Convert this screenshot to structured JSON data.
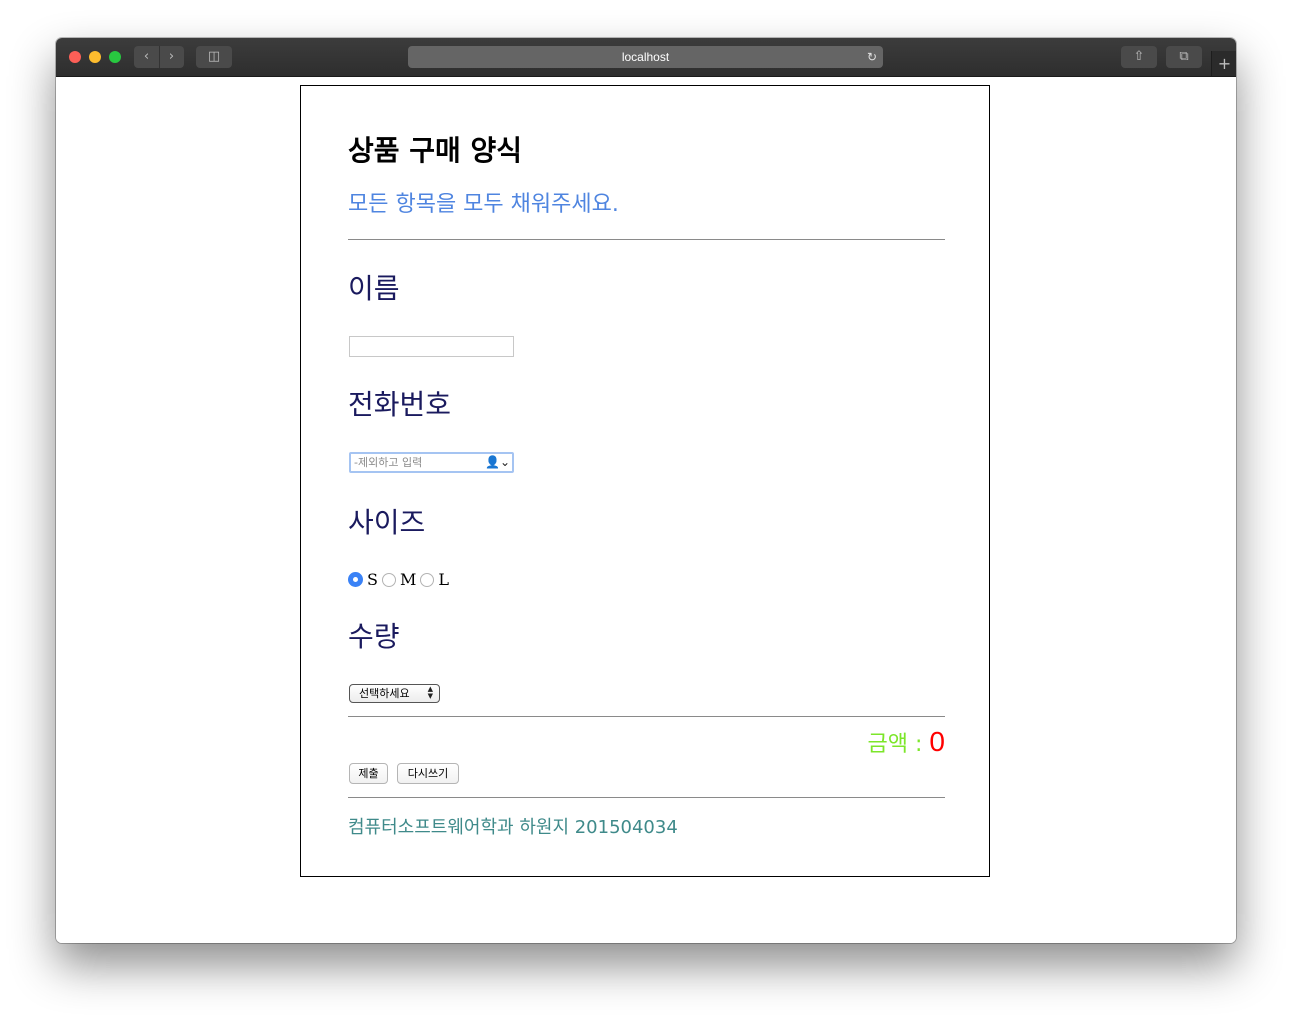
{
  "browser": {
    "url": "localhost",
    "back_icon": "chevron-left-icon",
    "forward_icon": "chevron-right-icon",
    "reload_icon": "reload-icon",
    "share_icon": "share-icon",
    "tabs_icon": "tabs-icon",
    "new_tab_label": "+"
  },
  "form": {
    "title": "상품 구매 양식",
    "subtitle": "모든 항목을 모두 채워주세요.",
    "name_label": "이름",
    "name_value": "",
    "phone_label": "전화번호",
    "phone_placeholder": "-제외하고 입력",
    "size_label": "사이즈",
    "size_options": [
      {
        "label": "S",
        "checked": true
      },
      {
        "label": "M",
        "checked": false
      },
      {
        "label": "L",
        "checked": false
      }
    ],
    "quantity_label": "수량",
    "quantity_selected": "선택하세요",
    "price_label": "금액 : ",
    "price_value": "0",
    "submit_label": "제출",
    "reset_label": "다시쓰기",
    "footer": "컴퓨터소프트웨어학과 하원지 201504034"
  },
  "colors": {
    "subtitle": "#4f85e0",
    "section_label": "#1a1a5e",
    "price_label": "#7ce62a",
    "price_value": "#ff0000",
    "footer": "#3f8a8a",
    "radio_checked": "#3a82f6"
  }
}
